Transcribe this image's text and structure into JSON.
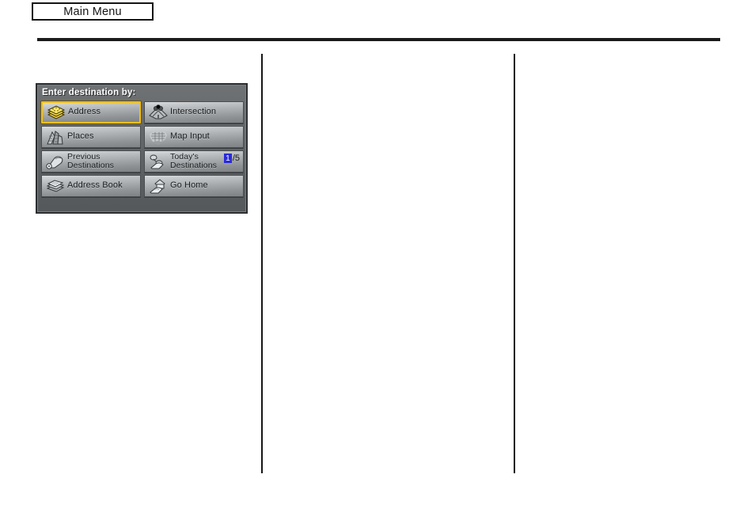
{
  "header": {
    "main_menu_label": "Main Menu"
  },
  "nav_screen": {
    "title": "Enter destination by:",
    "highlight_color": "#f2c014",
    "badge_color": "#2a2ad8",
    "buttons": [
      {
        "label": "Address",
        "icon": "stacked-maps-icon",
        "selected": true
      },
      {
        "label": "Intersection",
        "icon": "crossroads-icon",
        "selected": false
      },
      {
        "label": "Places",
        "icon": "city-buildings-icon",
        "selected": false
      },
      {
        "label": "Map Input",
        "icon": "us-map-icon",
        "selected": false
      },
      {
        "label": "Previous\nDestinations",
        "icon": "hand-pointer-icon",
        "selected": false
      },
      {
        "label": "Today's\nDestinations",
        "icon": "hand-list-icon",
        "selected": false
      },
      {
        "label": "Address Book",
        "icon": "address-book-icon",
        "selected": false
      },
      {
        "label": "Go Home",
        "icon": "house-hand-icon",
        "selected": false
      }
    ],
    "todays_destinations_counter": {
      "current": "1",
      "separator": "/",
      "total": "5"
    }
  }
}
